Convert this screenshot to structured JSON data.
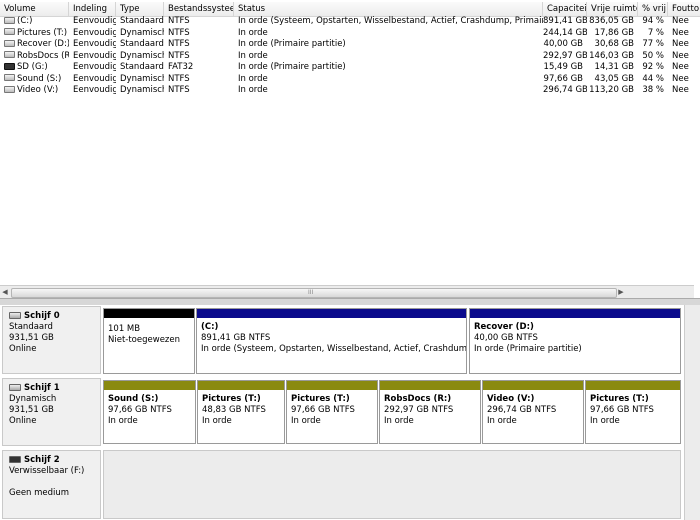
{
  "colors": {
    "unallocated": "#000000",
    "primary": "#0a0a8c",
    "dynamic": "#8a8a10"
  },
  "volume_list": {
    "columns": [
      "Volume",
      "Indeling",
      "Type",
      "Bestandssysteem",
      "Status",
      "Capaciteit",
      "Vrije ruimte",
      "% vrij",
      "Foutto"
    ],
    "rows": [
      [
        "(C:)",
        "Eenvoudig",
        "Standaard",
        "NTFS",
        "In orde (Systeem, Opstarten, Wisselbestand, Actief, Crashdump, Primaire partitie)",
        "891,41 GB",
        "836,05 GB",
        "94 %",
        "Nee"
      ],
      [
        "Pictures (T:)",
        "Eenvoudig",
        "Dynamisch",
        "NTFS",
        "In orde",
        "244,14 GB",
        "17,86 GB",
        "7 %",
        "Nee"
      ],
      [
        "Recover (D:)",
        "Eenvoudig",
        "Standaard",
        "NTFS",
        "In orde (Primaire partitie)",
        "40,00 GB",
        "30,68 GB",
        "77 %",
        "Nee"
      ],
      [
        "RobsDocs (R:)",
        "Eenvoudig",
        "Dynamisch",
        "NTFS",
        "In orde",
        "292,97 GB",
        "146,03 GB",
        "50 %",
        "Nee"
      ],
      [
        "SD (G:)",
        "Eenvoudig",
        "Standaard",
        "FAT32",
        "In orde (Primaire partitie)",
        "15,49 GB",
        "14,31 GB",
        "92 %",
        "Nee"
      ],
      [
        "Sound (S:)",
        "Eenvoudig",
        "Dynamisch",
        "NTFS",
        "In orde",
        "97,66 GB",
        "43,05 GB",
        "44 %",
        "Nee"
      ],
      [
        "Video (V:)",
        "Eenvoudig",
        "Dynamisch",
        "NTFS",
        "In orde",
        "296,74 GB",
        "113,20 GB",
        "38 %",
        "Nee"
      ]
    ],
    "icons": [
      "drive-icon",
      "drive-icon",
      "drive-icon",
      "drive-icon",
      "sd-card-icon",
      "drive-icon",
      "drive-icon"
    ],
    "hscroll_grip": "III",
    "arrow_left": "◀",
    "arrow_right": "▶"
  },
  "disks": [
    {
      "name": "Schijf 0",
      "type": "Standaard",
      "size": "931,51 GB",
      "state": "Online",
      "partitions": [
        {
          "name": "",
          "line1": "101 MB",
          "line2": "Niet-toegewezen",
          "color_key": "unallocated"
        },
        {
          "name": "(C:)",
          "line1": "891,41 GB NTFS",
          "line2": "In orde (Systeem, Opstarten, Wisselbestand, Actief, Crashdump, Primai",
          "color_key": "primary"
        },
        {
          "name": "Recover  (D:)",
          "line1": "40,00 GB NTFS",
          "line2": "In orde (Primaire partitie)",
          "color_key": "primary"
        }
      ]
    },
    {
      "name": "Schijf 1",
      "type": "Dynamisch",
      "size": "931,51 GB",
      "state": "Online",
      "partitions": [
        {
          "name": "Sound  (S:)",
          "line1": "97,66 GB NTFS",
          "line2": "In orde",
          "color_key": "dynamic"
        },
        {
          "name": "Pictures  (T:)",
          "line1": "48,83 GB NTFS",
          "line2": "In orde",
          "color_key": "dynamic"
        },
        {
          "name": "Pictures  (T:)",
          "line1": "97,66 GB NTFS",
          "line2": "In orde",
          "color_key": "dynamic"
        },
        {
          "name": "RobsDocs  (R:)",
          "line1": "292,97 GB NTFS",
          "line2": "In orde",
          "color_key": "dynamic"
        },
        {
          "name": "Video  (V:)",
          "line1": "296,74 GB NTFS",
          "line2": "In orde",
          "color_key": "dynamic"
        },
        {
          "name": "Pictures  (T:)",
          "line1": "97,66 GB NTFS",
          "line2": "In orde",
          "color_key": "dynamic"
        }
      ]
    },
    {
      "name": "Schijf 2",
      "type": "Verwisselbaar (F:)",
      "size": "",
      "state": "Geen medium",
      "partitions": []
    }
  ]
}
